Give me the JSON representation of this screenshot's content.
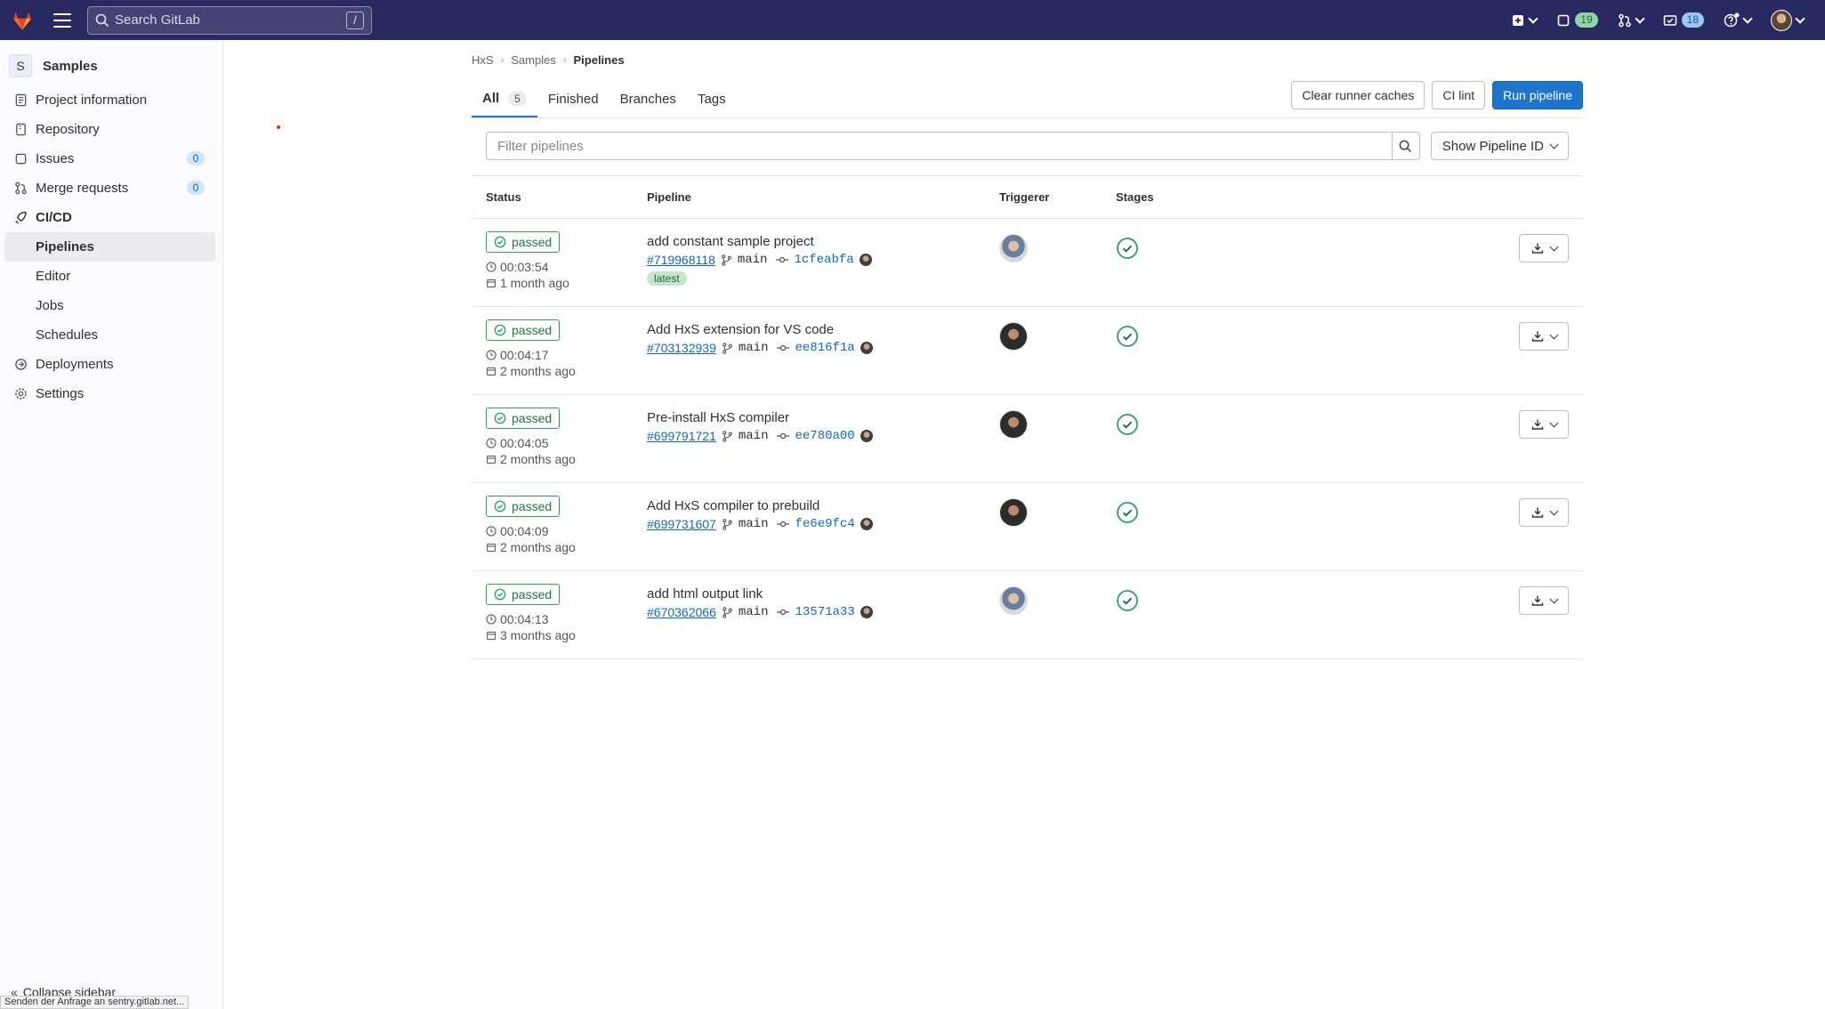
{
  "topbar": {
    "search_placeholder": "Search GitLab",
    "search_shortcut": "/",
    "issues_count": "19",
    "todos_count": "18"
  },
  "sidebar": {
    "project_initial": "S",
    "project_name": "Samples",
    "items": {
      "project_info": "Project information",
      "repository": "Repository",
      "issues": "Issues",
      "issues_count": "0",
      "merge_requests": "Merge requests",
      "merge_requests_count": "0",
      "cicd": "CI/CD",
      "pipelines": "Pipelines",
      "editor": "Editor",
      "jobs": "Jobs",
      "schedules": "Schedules",
      "deployments": "Deployments",
      "settings": "Settings"
    },
    "collapse_label": "Collapse sidebar"
  },
  "status_bar": "Senden der Anfrage an sentry.gitlab.net...",
  "breadcrumb": {
    "group": "HxS",
    "project": "Samples",
    "current": "Pipelines"
  },
  "tabs": {
    "all": "All",
    "all_count": "5",
    "finished": "Finished",
    "branches": "Branches",
    "tags": "Tags"
  },
  "actions": {
    "clear_caches": "Clear runner caches",
    "ci_lint": "CI lint",
    "run_pipeline": "Run pipeline"
  },
  "filter": {
    "placeholder": "Filter pipelines",
    "show_id": "Show Pipeline ID"
  },
  "table": {
    "headers": {
      "status": "Status",
      "pipeline": "Pipeline",
      "triggerer": "Triggerer",
      "stages": "Stages"
    },
    "rows": [
      {
        "status": "passed",
        "duration": "00:03:54",
        "ago": "1 month ago",
        "title": "add constant sample project",
        "id": "#719968118",
        "branch": "main",
        "sha": "1cfeabfa",
        "latest": "latest",
        "avatar": "a"
      },
      {
        "status": "passed",
        "duration": "00:04:17",
        "ago": "2 months ago",
        "title": "Add HxS extension for VS code",
        "id": "#703132939",
        "branch": "main",
        "sha": "ee816f1a",
        "latest": "",
        "avatar": "b"
      },
      {
        "status": "passed",
        "duration": "00:04:05",
        "ago": "2 months ago",
        "title": "Pre-install HxS compiler",
        "id": "#699791721",
        "branch": "main",
        "sha": "ee780a00",
        "latest": "",
        "avatar": "b"
      },
      {
        "status": "passed",
        "duration": "00:04:09",
        "ago": "2 months ago",
        "title": "Add HxS compiler to prebuild",
        "id": "#699731607",
        "branch": "main",
        "sha": "fe6e9fc4",
        "latest": "",
        "avatar": "b"
      },
      {
        "status": "passed",
        "duration": "00:04:13",
        "ago": "3 months ago",
        "title": "add html output link",
        "id": "#670362066",
        "branch": "main",
        "sha": "13571a33",
        "latest": "",
        "avatar": "a"
      }
    ]
  },
  "colors": {
    "nav_bg": "#292961",
    "success": "#2da160",
    "primary": "#1f75cb",
    "link": "#1068bf"
  }
}
